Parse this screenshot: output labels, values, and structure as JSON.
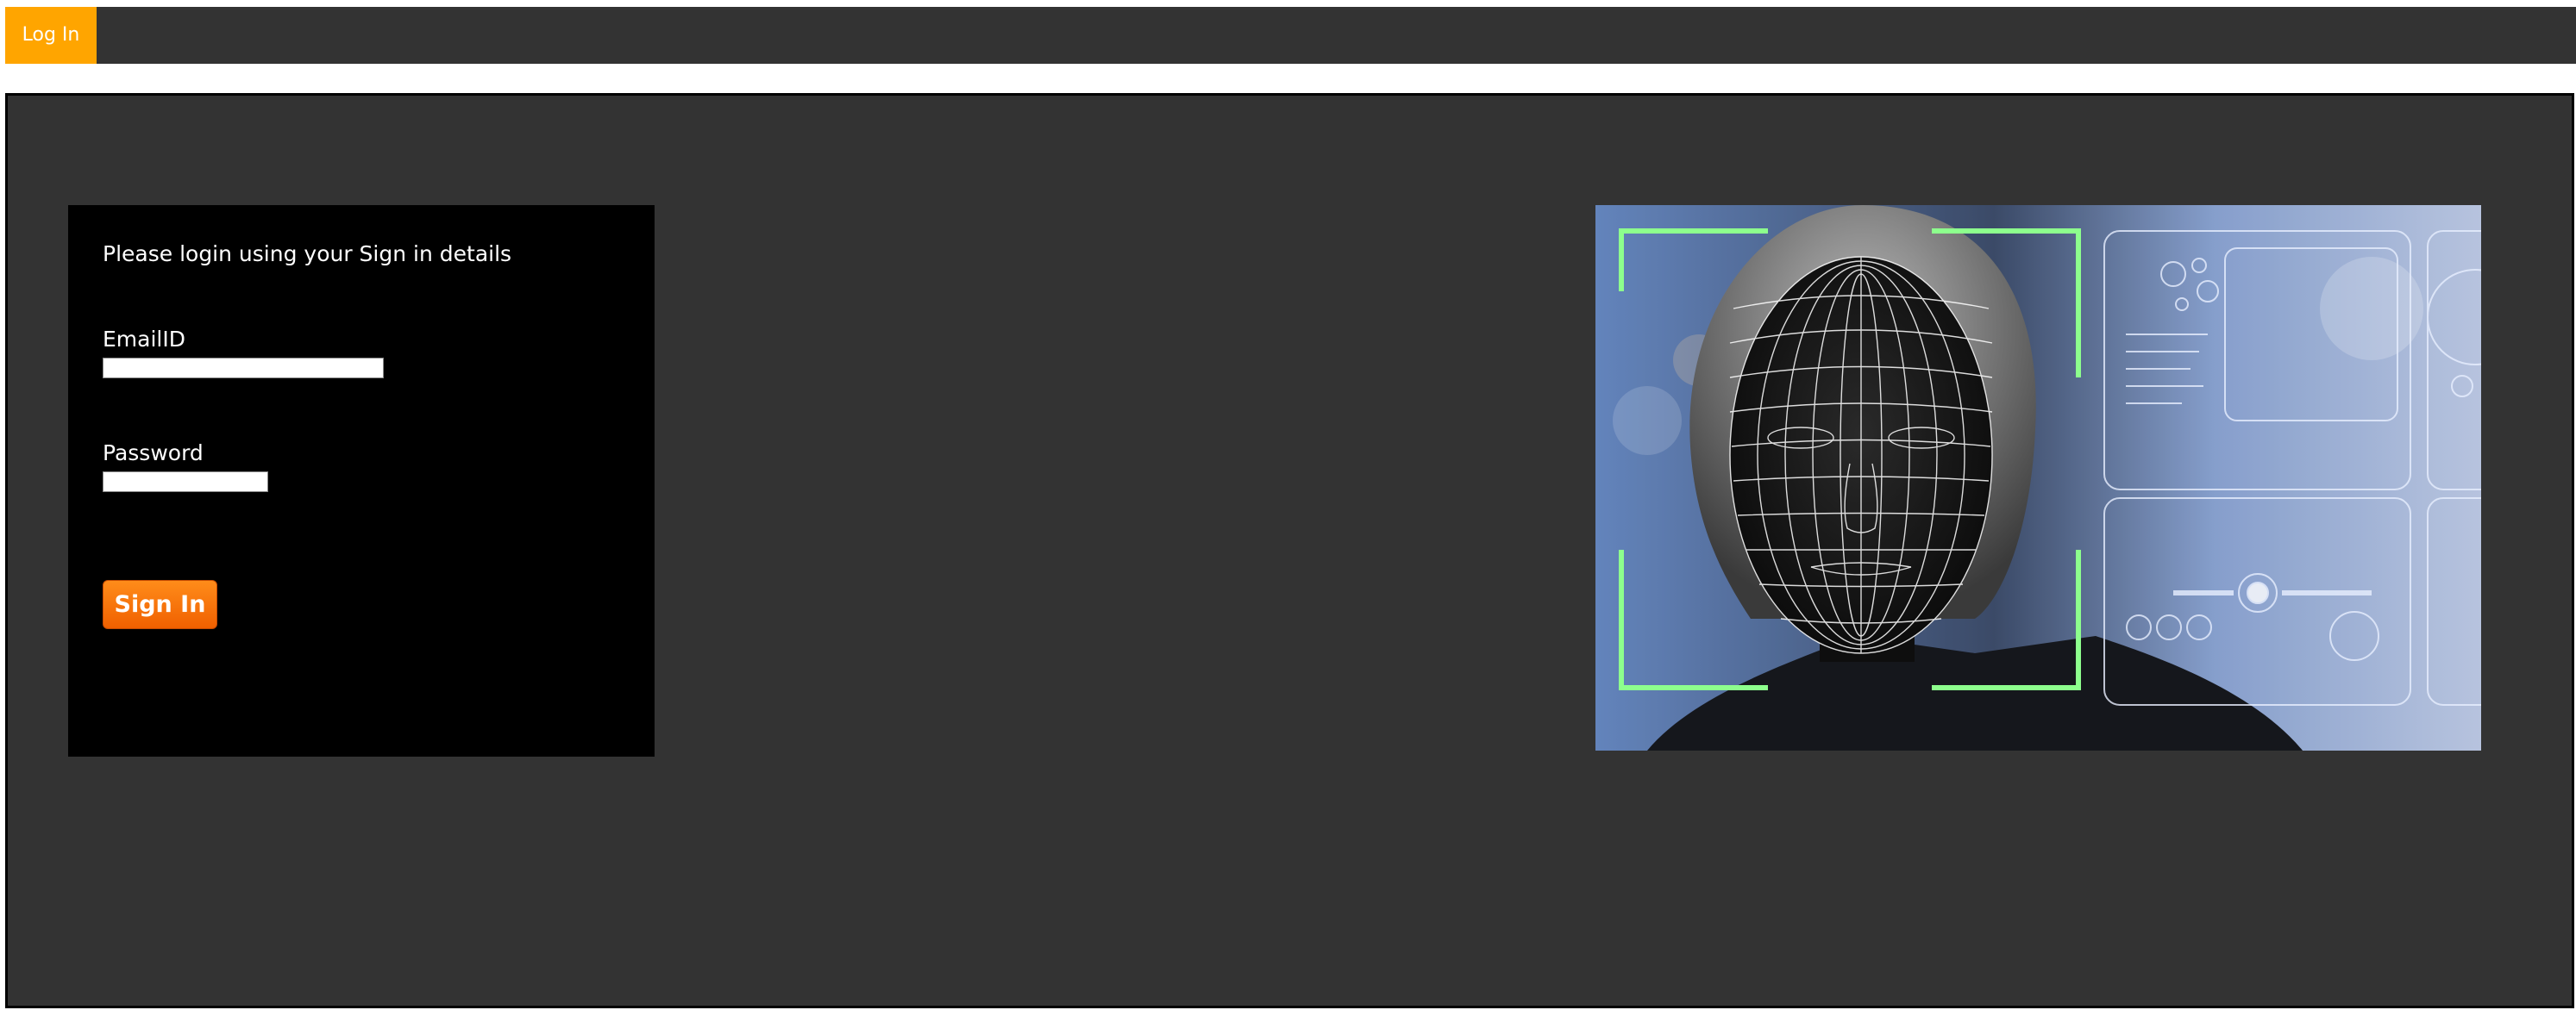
{
  "topbar": {
    "login_tab_label": "Log In",
    "background_color": "#333333",
    "tab_color": "#ffa500"
  },
  "login_form": {
    "heading": "Please login using your Sign in details",
    "email_label": "EmailID",
    "email_value": "",
    "password_label": "Password",
    "password_value": "",
    "signin_label": "Sign In",
    "button_color": "#ff7a00"
  },
  "hero_image": {
    "subject": "face-recognition-illustration",
    "accent_color": "#7dff7d"
  }
}
